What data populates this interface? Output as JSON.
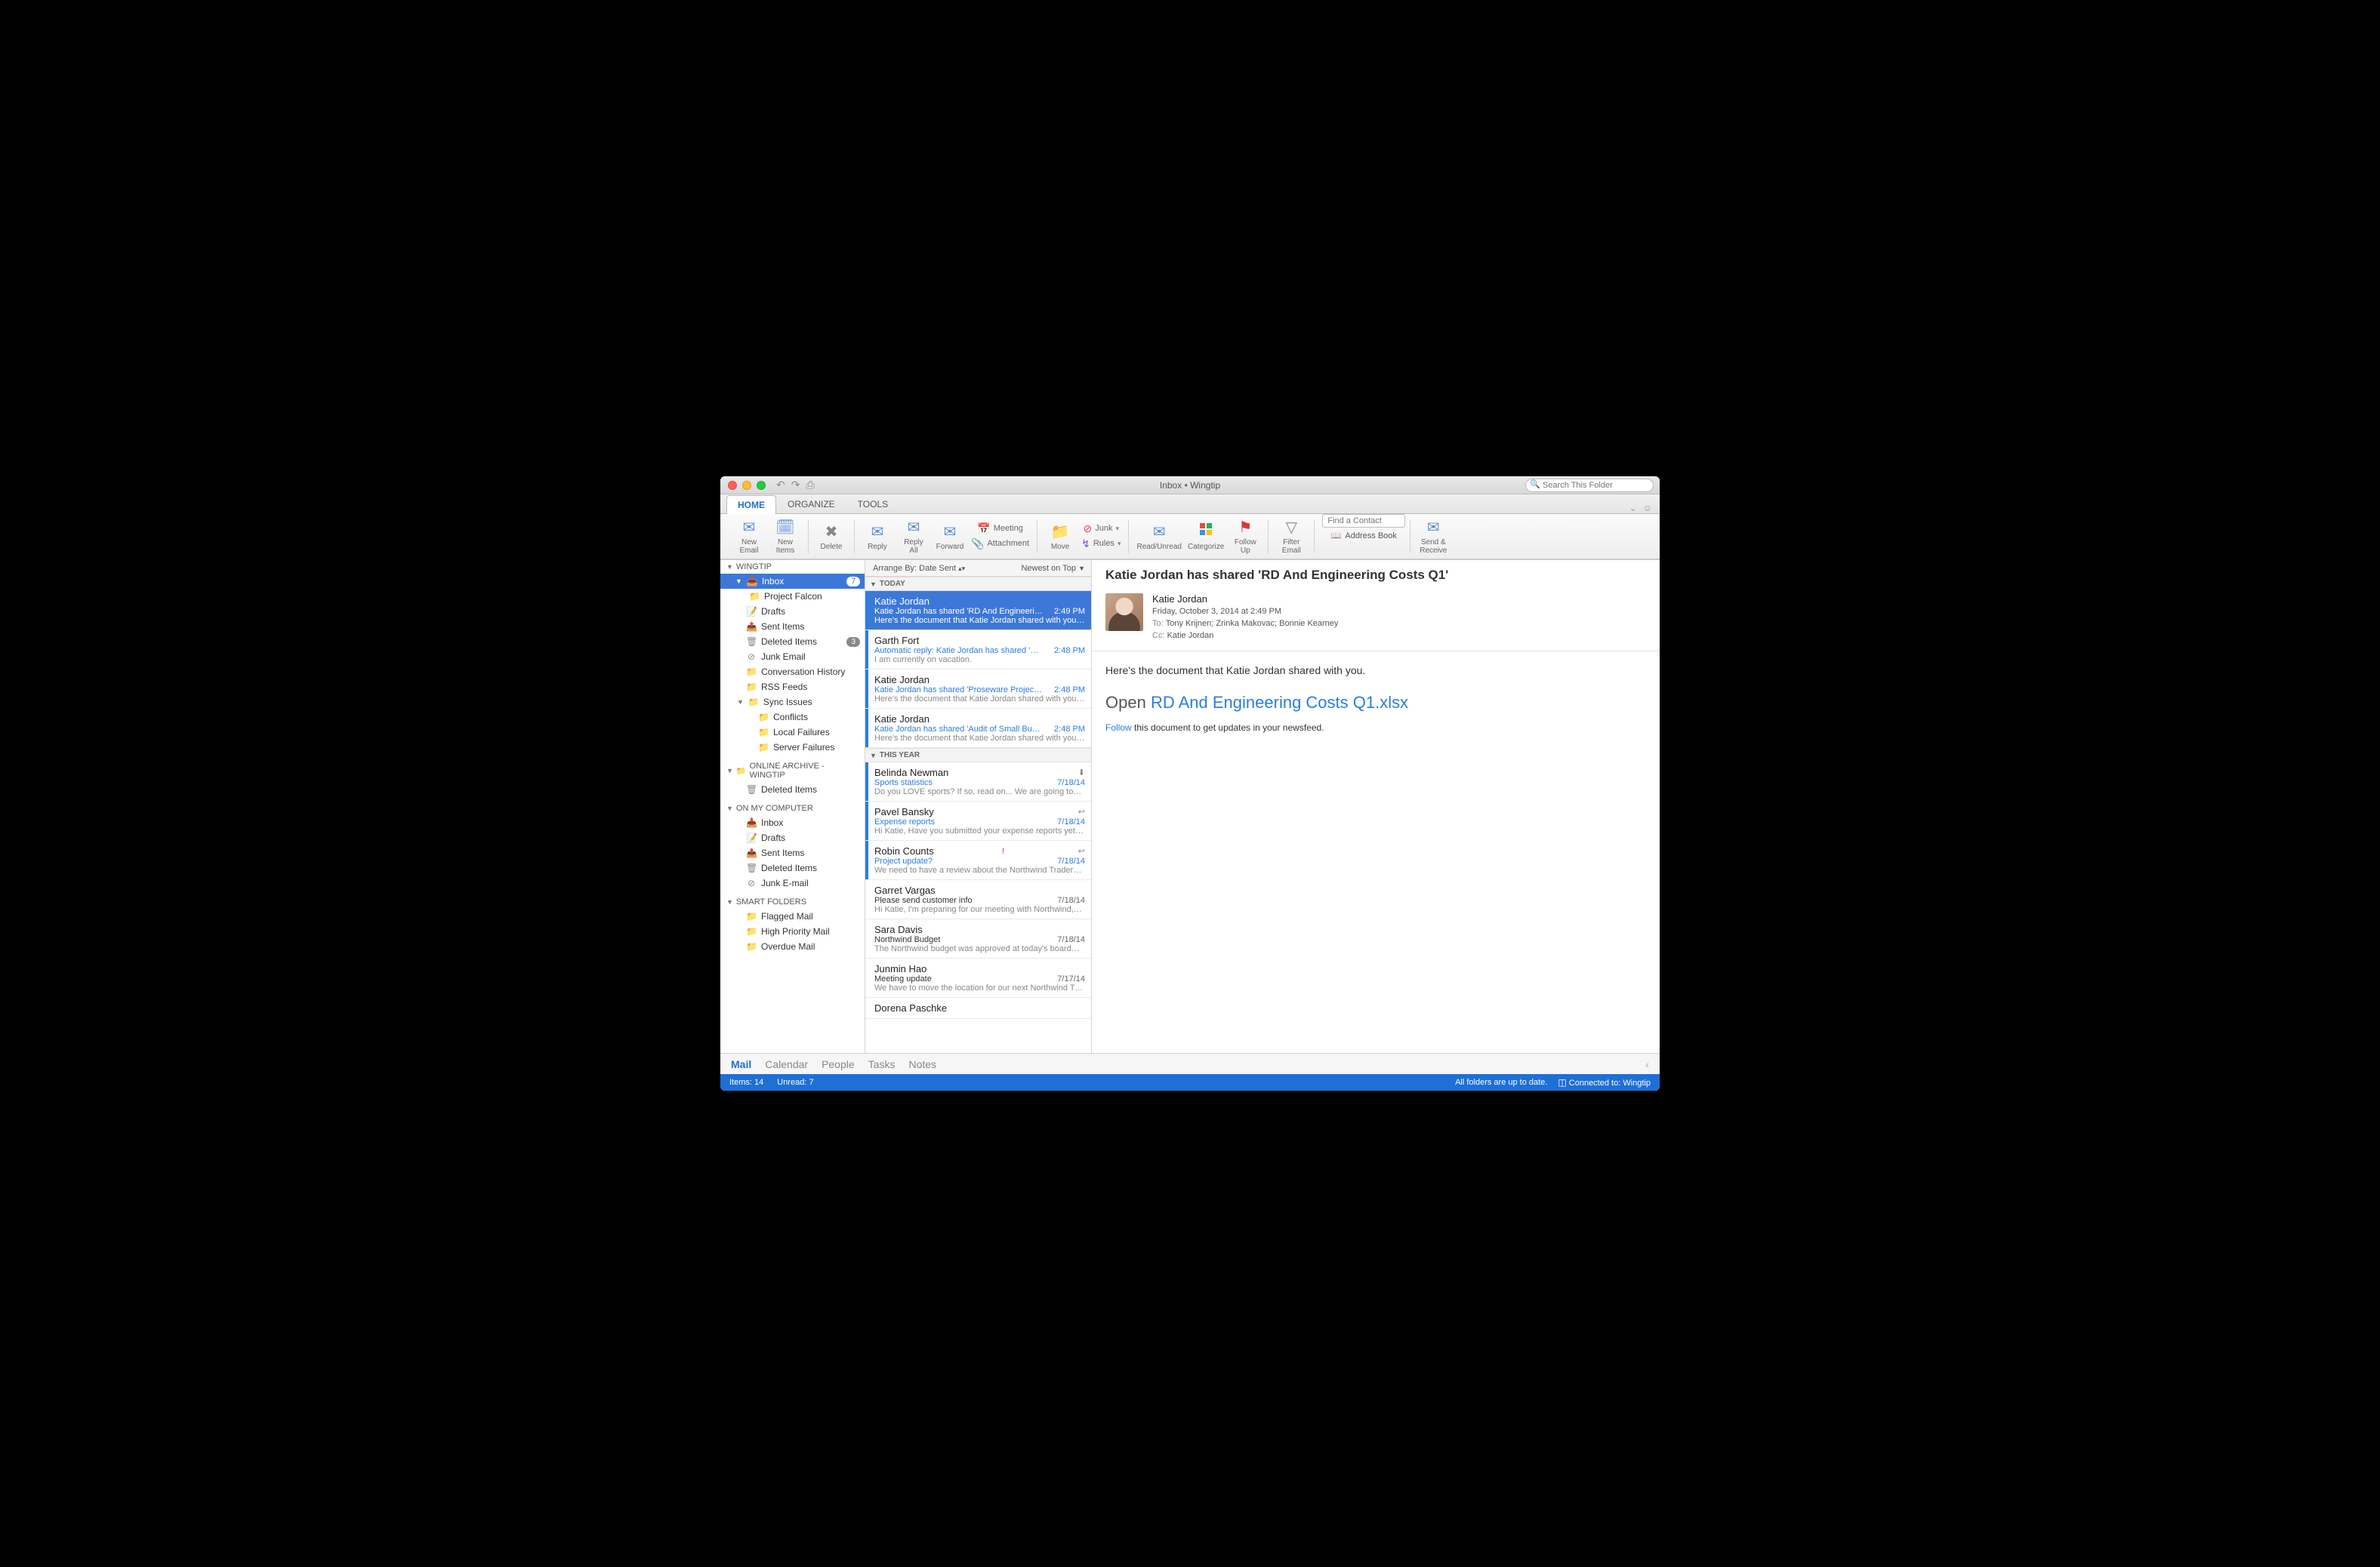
{
  "window": {
    "title": "Inbox • Wingtip"
  },
  "search": {
    "placeholder": "Search This Folder"
  },
  "tabs": {
    "home": "HOME",
    "organize": "ORGANIZE",
    "tools": "TOOLS"
  },
  "ribbon": {
    "new_email": "New\nEmail",
    "new_items": "New\nItems",
    "delete": "Delete",
    "reply": "Reply",
    "reply_all": "Reply\nAll",
    "forward": "Forward",
    "meeting": "Meeting",
    "attachment": "Attachment",
    "move": "Move",
    "junk": "Junk",
    "rules": "Rules",
    "read_unread": "Read/Unread",
    "categorize": "Categorize",
    "follow_up": "Follow\nUp",
    "filter_email": "Filter\nEmail",
    "find_contact": "Find a Contact",
    "address_book": "Address Book",
    "send_receive": "Send &\nReceive"
  },
  "folders": {
    "acct1": "WINGTIP",
    "inbox": "Inbox",
    "inbox_badge": "7",
    "project_falcon": "Project Falcon",
    "drafts": "Drafts",
    "sent": "Sent Items",
    "deleted": "Deleted Items",
    "deleted_badge": "3",
    "junk": "Junk Email",
    "conv": "Conversation History",
    "rss": "RSS Feeds",
    "sync": "Sync Issues",
    "conflicts": "Conflicts",
    "local_fail": "Local Failures",
    "server_fail": "Server Failures",
    "archive": "Online Archive - Wingtip",
    "archive_deleted": "Deleted Items",
    "onmy": "ON MY COMPUTER",
    "oc_inbox": "Inbox",
    "oc_drafts": "Drafts",
    "oc_sent": "Sent Items",
    "oc_deleted": "Deleted Items",
    "oc_junk": "Junk E-mail",
    "smart": "SMART FOLDERS",
    "flagged": "Flagged Mail",
    "highpri": "High Priority Mail",
    "overdue": "Overdue Mail"
  },
  "arrange": {
    "by": "Arrange By: Date Sent",
    "sort": "Newest on Top"
  },
  "groups": {
    "today": "TODAY",
    "this_year": "THIS YEAR"
  },
  "messages": [
    {
      "from": "Katie Jordan",
      "subject": "Katie Jordan has shared 'RD And Engineeri…",
      "time": "2:49 PM",
      "preview": "Here's the document that Katie Jordan shared with you…",
      "unread": true,
      "selected": true
    },
    {
      "from": "Garth Fort",
      "subject": "Automatic reply: Katie Jordan has shared '…",
      "time": "2:48 PM",
      "preview": "I am currently on vacation.",
      "unread": true
    },
    {
      "from": "Katie Jordan",
      "subject": "Katie Jordan has shared 'Proseware Projec…",
      "time": "2:48 PM",
      "preview": "Here's the document that Katie Jordan shared with you…",
      "unread": true
    },
    {
      "from": "Katie Jordan",
      "subject": "Katie Jordan has shared 'Audit of Small Bu…",
      "time": "2:48 PM",
      "preview": "Here's the document that Katie Jordan shared with you…",
      "unread": true
    },
    {
      "from": "Belinda Newman",
      "subject": "Sports statistics",
      "time": "7/18/14",
      "preview": "Do you LOVE sports? If so, read on... We are going to…",
      "unread": true,
      "flag": "fwd"
    },
    {
      "from": "Pavel Bansky",
      "subject": "Expense reports",
      "time": "7/18/14",
      "preview": "Hi Katie, Have you submitted your expense reports yet…",
      "unread": true,
      "flag": "rep"
    },
    {
      "from": "Robin Counts",
      "subject": "Project update?",
      "time": "7/18/14",
      "preview": "We need to have a review about the Northwind Traders…",
      "unread": true,
      "flag": "imp-rep"
    },
    {
      "from": "Garret Vargas",
      "subject": "Please send customer info",
      "time": "7/18/14",
      "preview": "Hi Katie, I'm preparing for our meeting with Northwind,…",
      "read": true
    },
    {
      "from": "Sara Davis",
      "subject": "Northwind Budget",
      "time": "7/18/14",
      "preview": "The Northwind budget was approved at today's board…",
      "read": true
    },
    {
      "from": "Junmin Hao",
      "subject": "Meeting update",
      "time": "7/17/14",
      "preview": "We have to move the location for our next Northwind Tr…",
      "read": true
    },
    {
      "from": "Dorena Paschke",
      "subject": "",
      "time": "",
      "preview": "",
      "read": true
    }
  ],
  "reading": {
    "title": "Katie Jordan has shared 'RD And Engineering Costs Q1'",
    "from": "Katie Jordan",
    "date": "Friday, October 3, 2014 at 2:49 PM",
    "to_label": "To:",
    "to": "Tony Krijnen;   Zrinka Makovac;   Bonnie Kearney",
    "cc_label": "Cc:",
    "cc": "Katie Jordan",
    "body_intro": "Here's the document that Katie Jordan shared with you.",
    "open_word": "Open",
    "doc_link": "RD And Engineering Costs Q1.xlsx",
    "follow_link": "Follow",
    "follow_rest": " this document to get updates in your newsfeed."
  },
  "nav": {
    "mail": "Mail",
    "calendar": "Calendar",
    "people": "People",
    "tasks": "Tasks",
    "notes": "Notes"
  },
  "status": {
    "items": "Items: 14",
    "unread": "Unread: 7",
    "sync": "All folders are up to date.",
    "connected": "Connected to: Wingtip"
  }
}
